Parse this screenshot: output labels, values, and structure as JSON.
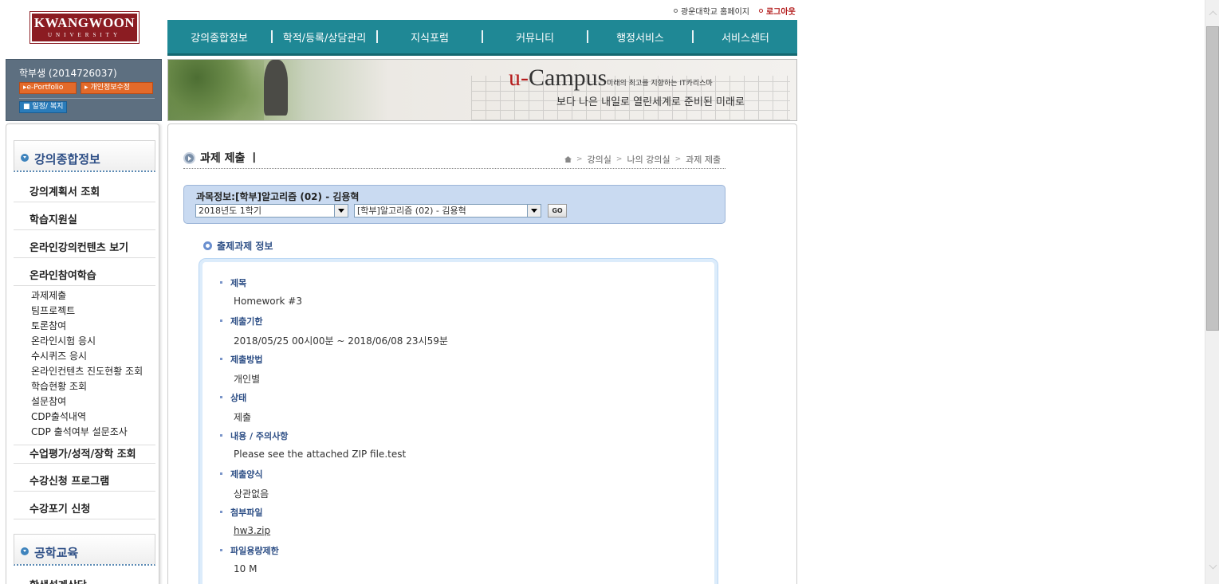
{
  "logo": {
    "main": "KWANGWOON",
    "sub": "UNIVERSITY"
  },
  "top_links": {
    "homepage": "광운대학교 홈페이지",
    "logout": "로그아웃"
  },
  "main_nav": [
    "강의종합정보",
    "학적/등록/상담관리",
    "지식포럼",
    "커뮤니티",
    "행정서비스",
    "서비스센터"
  ],
  "user": {
    "name": "학부생 (2014726037)",
    "eportfolio": "▸e-Portfolio",
    "edit_info": "▸ 개인정보수정",
    "schedule": "■ 일정/ 복지"
  },
  "banner": {
    "brand_u": "u-",
    "brand": "Campus",
    "tagline": "미래의 최고를 지향하는 IT카리스마",
    "slogan": "보다 나은 내일로 열린세계로 준비된 미래로"
  },
  "left_menu": {
    "section1": "강의종합정보",
    "items": [
      "강의계획서 조회",
      "학습지원실",
      "온라인강의컨텐츠 보기",
      "온라인참여학습"
    ],
    "subitems": [
      "과제제출",
      "팀프로젝트",
      "토론참여",
      "온라인시험 응시",
      "수시퀴즈 응시",
      "온라인컨텐츠 진도현황 조회",
      "학습현황 조회",
      "설문참여",
      "CDP출석내역",
      "CDP 출석여부 설문조사"
    ],
    "items2": [
      "수업평가/성적/장학 조회",
      "수강신청 프로그램",
      "수강포기 신청"
    ],
    "section2": "공학교육",
    "cut_item": "학생설계상담"
  },
  "page": {
    "title": "과제 제출 ㅣ",
    "breadcrumb": [
      "강의실",
      "나의 강의실",
      "과제 제출"
    ],
    "course_label": "과목정보:[학부]알고리즘 (02) - 김용혁",
    "semester_select": "2018년도 1학기",
    "course_select": "[학부]알고리즘 (02) - 김용혁",
    "go_button": "GO",
    "section_title": "출제과제 정보",
    "fields": [
      {
        "key": "제목",
        "value": "Homework #3"
      },
      {
        "key": "제출기한",
        "value": "2018/05/25 00시00분 ~ 2018/06/08 23시59분"
      },
      {
        "key": "제출방법",
        "value": "개인별"
      },
      {
        "key": "상태",
        "value": "제출"
      },
      {
        "key": "내용 / 주의사항",
        "value": "Please see the attached ZIP file.test"
      },
      {
        "key": "제출양식",
        "value": "상관없음"
      },
      {
        "key": "첨부파일",
        "value": "hw3.zip"
      },
      {
        "key": "파일용량제한",
        "value": "10 M"
      }
    ]
  },
  "colors": {
    "nav": "#1f8895",
    "brand_red": "#8b1c22",
    "label_blue": "#2e4f86",
    "course_bg": "#c9daf1"
  }
}
